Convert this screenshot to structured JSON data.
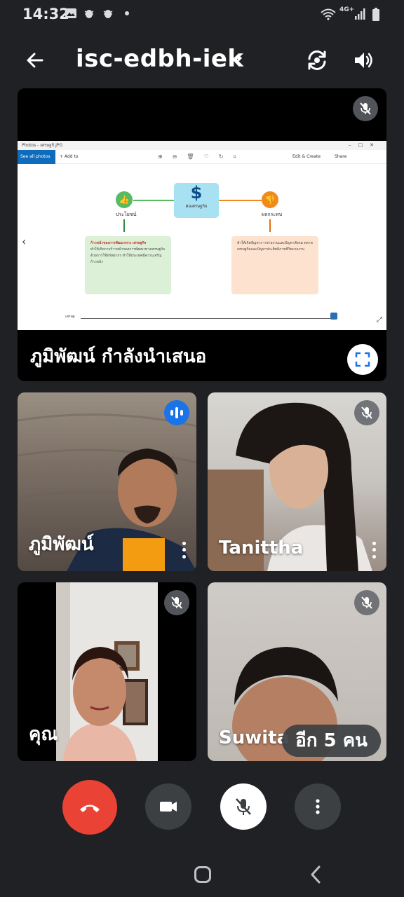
{
  "status_bar": {
    "time": "14:32",
    "network_type": "4G+",
    "icons": [
      "image-icon",
      "bug-icon",
      "bug-icon",
      "dot-icon",
      "wifi-icon",
      "signal-icon",
      "battery-icon"
    ]
  },
  "header": {
    "meeting_code": "isc-edbh-iek",
    "icons": [
      "back-arrow-icon",
      "chevron-right-icon",
      "switch-camera-icon",
      "speaker-icon"
    ]
  },
  "presentation": {
    "presenter_label": "ภูมิพัฒน์ กำลังนำเสนอ",
    "muted": true,
    "shared_app": {
      "window_title": "Photos - เศรษฐกิ.JPG",
      "see_all": "See all photos",
      "add_to": "+ Add to",
      "edit_create": "Edit & Create",
      "share": "Share",
      "center_label": "ค่อเศรษฐกิจ",
      "left_label": "ประโยชน์",
      "right_label": "ผลกระทบ",
      "left_card_text": "ทำให้เกิดการก้าวหน้าของการพัฒนาทางเศรษฐกิจ ด้วยการใช้ทรัพยากร ทำให้ประเทศมีความเจริญก้าวหน้า",
      "left_card_highlight": "ก้าวหน้าของการพัฒนาทาง เศรษฐกิจ",
      "right_card_text": "ทำให้เกิดปัญหาการจ่ายงานและปัญหาสังคม ตลาดเศรษฐกิจและปัญหาประสิทธิภาพชีวิตแรงงาน",
      "progress_label": "เศรษฐ"
    },
    "colors": {
      "center_box": "#a8e2f2",
      "left_icon": "#57bb63",
      "right_icon": "#f08a1f"
    }
  },
  "participants": [
    {
      "name": "ภูมิพัฒน์",
      "speaking": true,
      "muted": false
    },
    {
      "name": "Tanittha",
      "speaking": false,
      "muted": true
    },
    {
      "name": "คุณ",
      "speaking": false,
      "muted": true
    },
    {
      "name": "Suwita",
      "speaking": false,
      "muted": true
    }
  ],
  "more_participants": "อีก 5 คน",
  "controls": {
    "items": [
      "end-call",
      "camera",
      "microphone-muted",
      "more-options"
    ],
    "colors": {
      "end_call": "#ea4335",
      "neutral": "#3c4043",
      "active": "#ffffff"
    }
  },
  "system_nav": {
    "icons": [
      "home-icon",
      "back-icon"
    ]
  }
}
